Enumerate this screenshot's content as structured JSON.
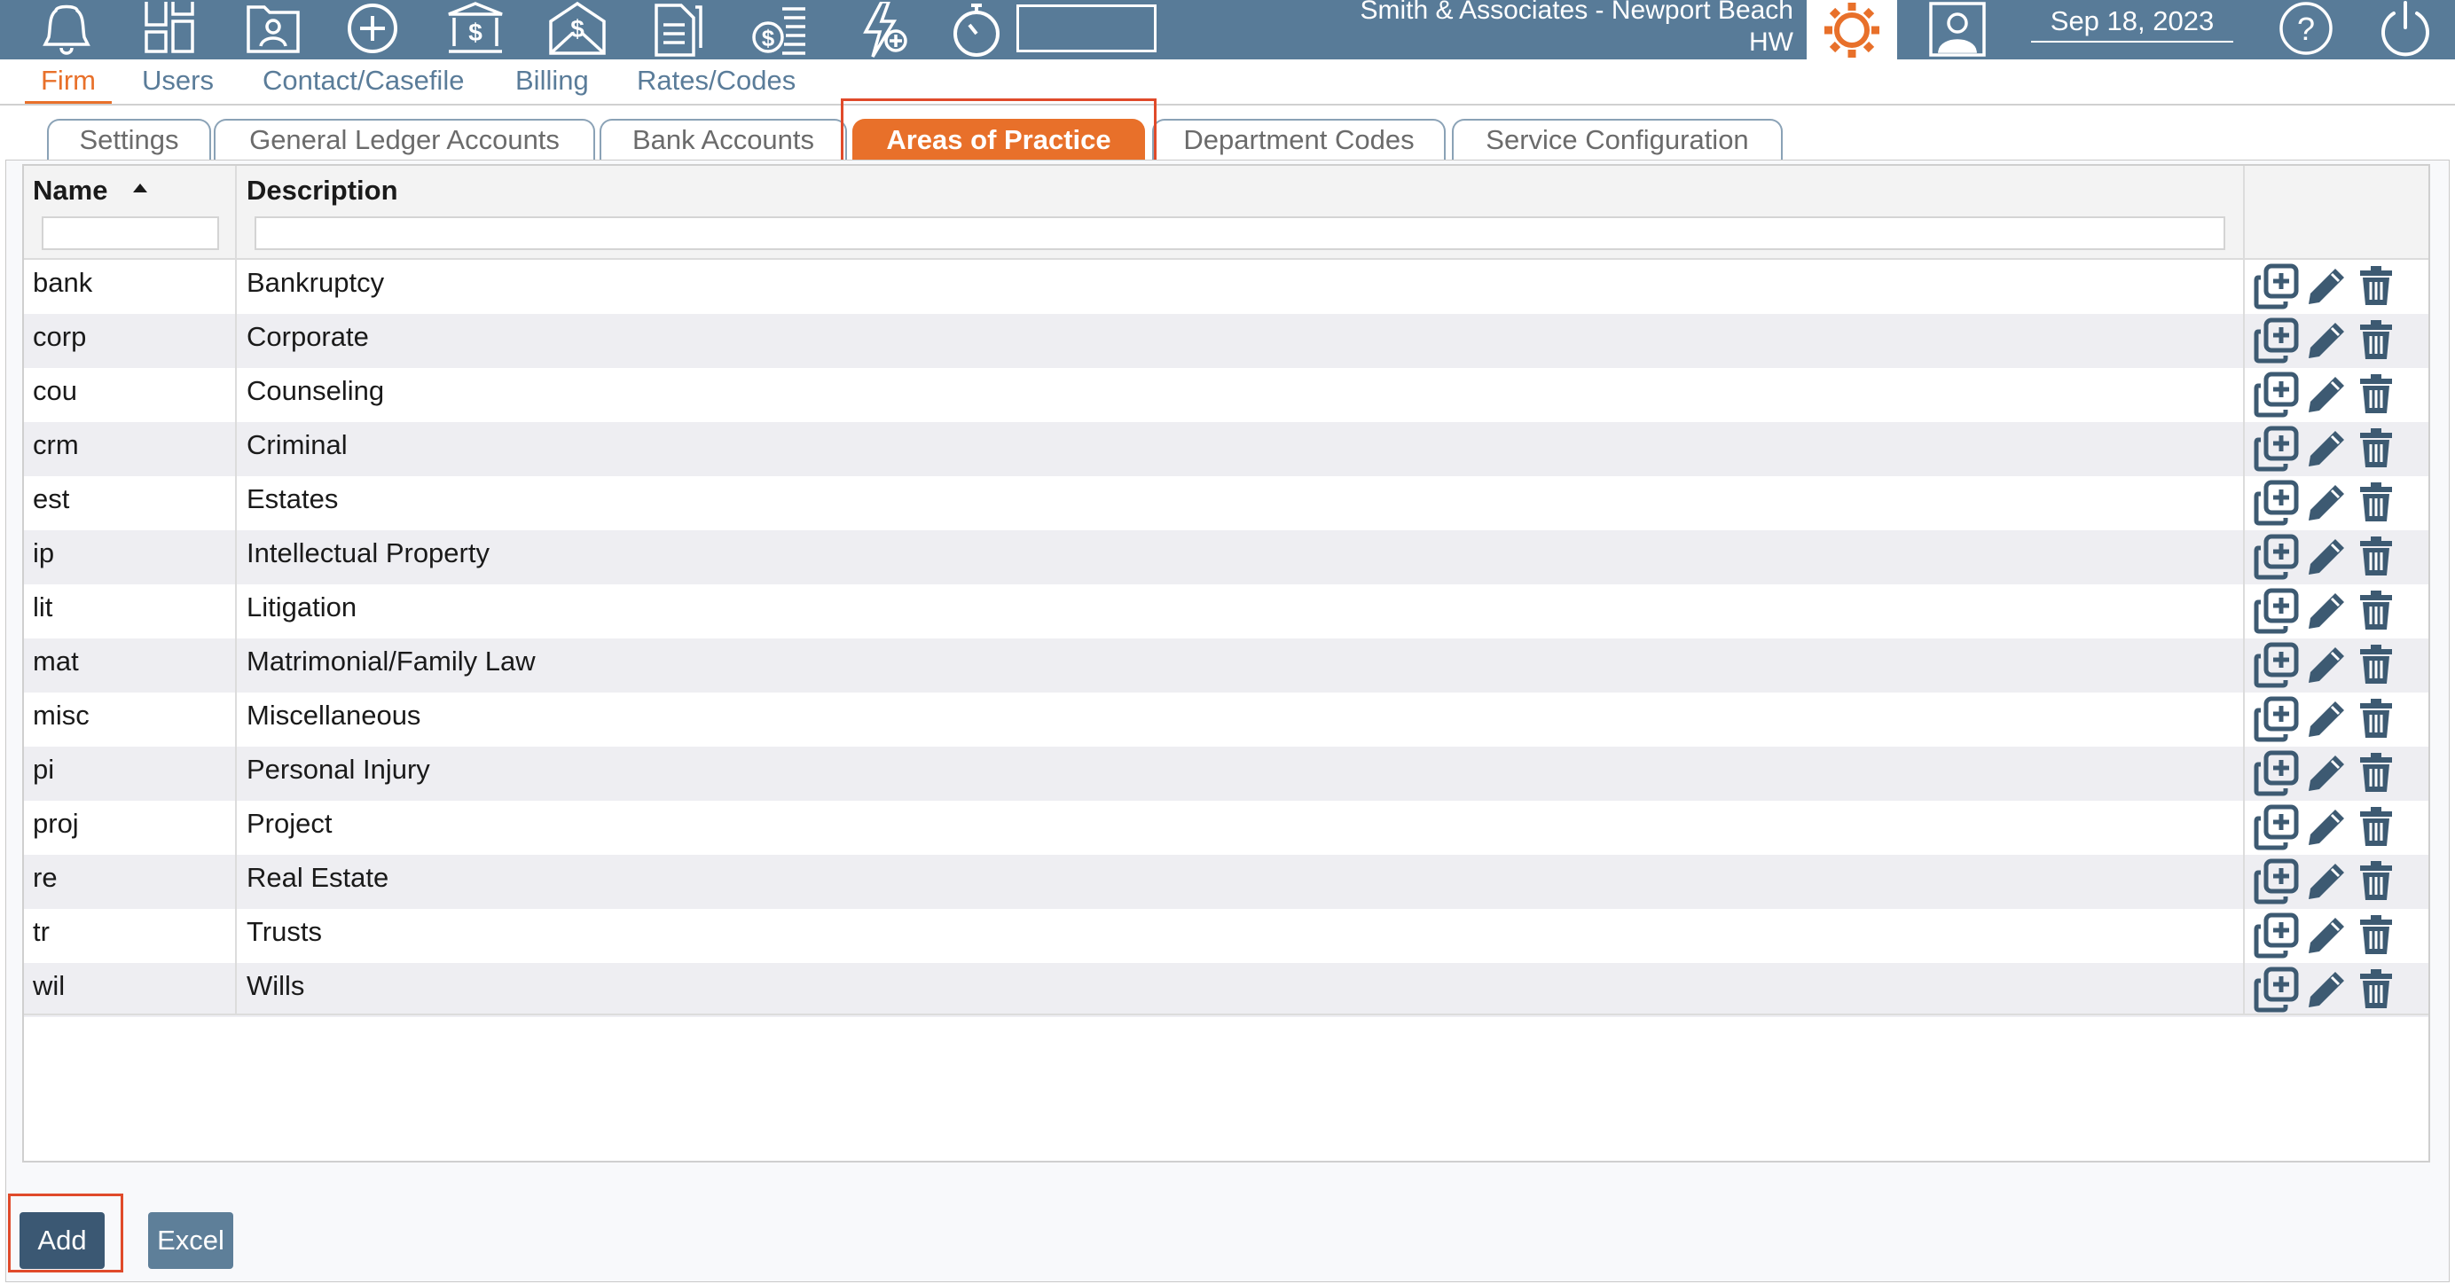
{
  "header": {
    "firm_line1": "Smith & Associates - Newport Beach",
    "firm_line2": "HW",
    "date": "Sep 18, 2023",
    "search_value": "",
    "icons": [
      "bell-icon",
      "dashboard-icon",
      "folder-person-icon",
      "add-circle-icon",
      "bank-icon",
      "envelope-dollar-icon",
      "document-icon",
      "coins-icon",
      "lightning-add-icon",
      "stopwatch-icon",
      "gear-icon",
      "user-icon",
      "help-icon",
      "power-icon"
    ]
  },
  "menu": {
    "items": [
      {
        "label": "Firm",
        "active": true
      },
      {
        "label": "Users"
      },
      {
        "label": "Contact/Casefile"
      },
      {
        "label": "Billing"
      },
      {
        "label": "Rates/Codes"
      }
    ]
  },
  "tabs": [
    {
      "label": "Settings"
    },
    {
      "label": "General Ledger Accounts"
    },
    {
      "label": "Bank Accounts"
    },
    {
      "label": "Areas of Practice",
      "active": true
    },
    {
      "label": "Department Codes"
    },
    {
      "label": "Service Configuration"
    }
  ],
  "grid": {
    "columns": [
      {
        "label": "Name",
        "sort": "ascending"
      },
      {
        "label": "Description"
      }
    ],
    "filters": {
      "name": "",
      "description": ""
    },
    "rows": [
      {
        "name": "bank",
        "description": "Bankruptcy"
      },
      {
        "name": "corp",
        "description": "Corporate"
      },
      {
        "name": "cou",
        "description": "Counseling"
      },
      {
        "name": "crm",
        "description": "Criminal"
      },
      {
        "name": "est",
        "description": "Estates"
      },
      {
        "name": "ip",
        "description": "Intellectual Property"
      },
      {
        "name": "lit",
        "description": "Litigation"
      },
      {
        "name": "mat",
        "description": "Matrimonial/Family Law"
      },
      {
        "name": "misc",
        "description": "Miscellaneous"
      },
      {
        "name": "pi",
        "description": "Personal Injury"
      },
      {
        "name": "proj",
        "description": "Project"
      },
      {
        "name": "re",
        "description": "Real Estate"
      },
      {
        "name": "tr",
        "description": "Trusts"
      },
      {
        "name": "wil",
        "description": "Wills"
      }
    ],
    "row_actions": [
      "copy-add-icon",
      "edit-pencil-icon",
      "delete-trash-icon"
    ]
  },
  "buttons": {
    "add": "Add",
    "excel": "Excel"
  },
  "colors": {
    "toolbar": "#587b98",
    "accent": "#e8702a",
    "menu_text": "#5a7c99",
    "highlight": "#e04a2a",
    "button_dark": "#3b5873",
    "button_light": "#5e7f99"
  }
}
